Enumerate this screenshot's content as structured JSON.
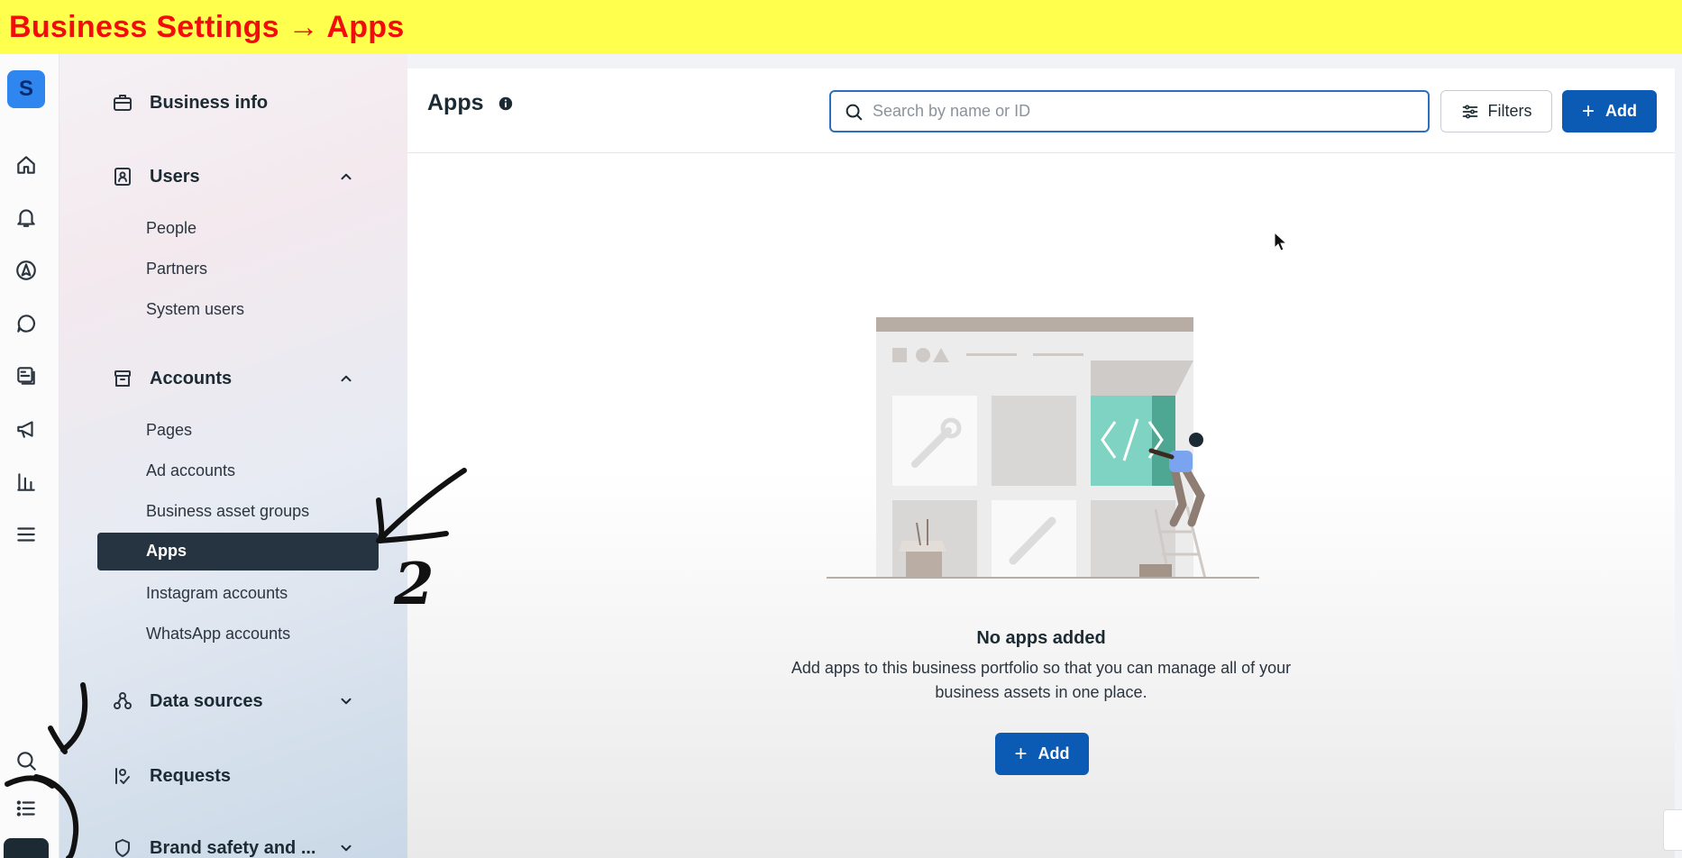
{
  "banner": {
    "title": "Business Settings → Apps"
  },
  "rail": {
    "avatar_letter": "S",
    "icons": [
      "home-icon",
      "bell-icon",
      "navigation-icon",
      "chat-icon",
      "pages-icon",
      "megaphone-icon",
      "bar-chart-icon",
      "menu-icon",
      "search-icon",
      "list-icon",
      "settings-icon"
    ]
  },
  "sidebar": {
    "business_info": "Business info",
    "users": {
      "label": "Users",
      "items": [
        "People",
        "Partners",
        "System users"
      ]
    },
    "accounts": {
      "label": "Accounts",
      "items": [
        "Pages",
        "Ad accounts",
        "Business asset groups",
        "Apps",
        "Instagram accounts",
        "WhatsApp accounts"
      ],
      "active": "Apps"
    },
    "data_sources": "Data sources",
    "requests": "Requests",
    "brand_safety": "Brand safety and ..."
  },
  "header": {
    "title": "Apps",
    "search_placeholder": "Search by name or ID",
    "filters_label": "Filters",
    "add_label": "Add"
  },
  "empty_state": {
    "title": "No apps added",
    "description": "Add apps to this business portfolio so that you can manage all of your business assets in one place.",
    "add_label": "Add"
  },
  "annotation_marks": {
    "number": "2"
  },
  "colors": {
    "banner_bg": "#ffff4d",
    "banner_text": "#f20d0d",
    "primary": "#0b5ab4",
    "active_nav": "#263341",
    "illustration_accent": "#7fd3c3"
  }
}
